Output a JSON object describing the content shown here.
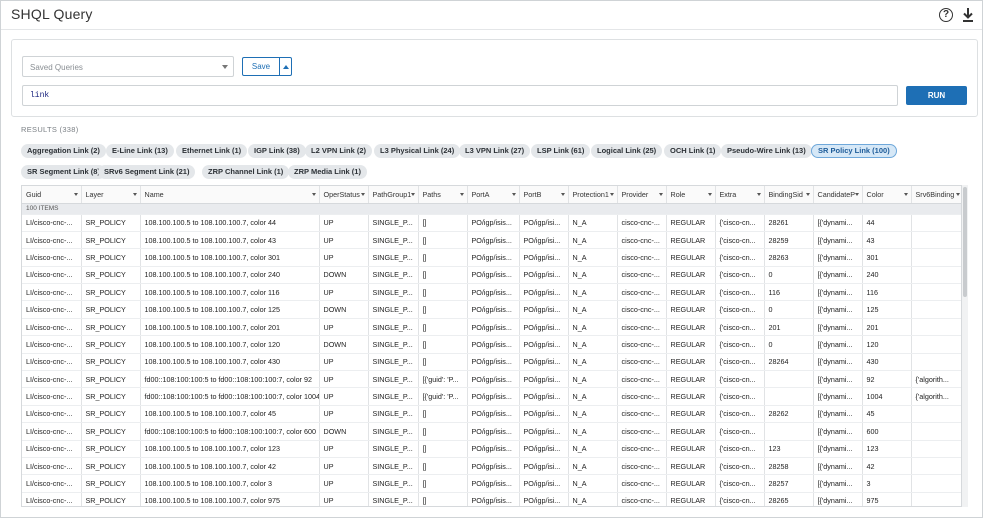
{
  "header": {
    "title": "SHQL Query",
    "help_icon": "help-icon",
    "download_icon": "download-icon"
  },
  "query_panel": {
    "saved_queries_placeholder": "Saved Queries",
    "save_label": "Save",
    "query_value": "link",
    "run_label": "RUN"
  },
  "results": {
    "label": "RESULTS (338)",
    "chips": [
      {
        "label": "Aggregation Link (2)",
        "active": false
      },
      {
        "label": "E-Line Link (13)",
        "active": false
      },
      {
        "label": "Ethernet Link (1)",
        "active": false
      },
      {
        "label": "IGP Link (38)",
        "active": false
      },
      {
        "label": "L2 VPN Link (2)",
        "active": false
      },
      {
        "label": "L3 Physical Link (24)",
        "active": false
      },
      {
        "label": "L3 VPN Link (27)",
        "active": false
      },
      {
        "label": "LSP Link (61)",
        "active": false
      },
      {
        "label": "Logical Link (25)",
        "active": false
      },
      {
        "label": "OCH Link (1)",
        "active": false
      },
      {
        "label": "Pseudo-Wire Link (13)",
        "active": false
      },
      {
        "label": "SR Policy Link (100)",
        "active": true
      },
      {
        "label": "SR Segment Link (8)",
        "active": false
      },
      {
        "label": "SRv6 Segment Link (21)",
        "active": false
      },
      {
        "label": "ZRP Channel Link (1)",
        "active": false
      },
      {
        "label": "ZRP Media Link (1)",
        "active": false
      }
    ]
  },
  "grid": {
    "columns": [
      "Guid",
      "Layer",
      "Name",
      "OperStatus",
      "PathGroup1",
      "Paths",
      "PortA",
      "PortB",
      "Protection1",
      "Provider",
      "Role",
      "Extra",
      "BindingSid",
      "CandidateP",
      "Color",
      "Srv6Binding"
    ],
    "group_label": "100 ITEMS",
    "rows": [
      [
        "LI/cisco-cnc-...",
        "SR_POLICY",
        "108.100.100.5 to 108.100.100.7, color 44",
        "UP",
        "SINGLE_P...",
        "[]",
        "PO/igp/isis...",
        "PO/igp/isi...",
        "N_A",
        "cisco-cnc-...",
        "REGULAR",
        "{'cisco-cn...",
        "28261",
        "[{'dynami...",
        "44",
        ""
      ],
      [
        "LI/cisco-cnc-...",
        "SR_POLICY",
        "108.100.100.5 to 108.100.100.7, color 43",
        "UP",
        "SINGLE_P...",
        "[]",
        "PO/igp/isis...",
        "PO/igp/isi...",
        "N_A",
        "cisco-cnc-...",
        "REGULAR",
        "{'cisco-cn...",
        "28259",
        "[{'dynami...",
        "43",
        ""
      ],
      [
        "LI/cisco-cnc-...",
        "SR_POLICY",
        "108.100.100.5 to 108.100.100.7, color 301",
        "UP",
        "SINGLE_P...",
        "[]",
        "PO/igp/isis...",
        "PO/igp/isi...",
        "N_A",
        "cisco-cnc-...",
        "REGULAR",
        "{'cisco-cn...",
        "28263",
        "[{'dynami...",
        "301",
        ""
      ],
      [
        "LI/cisco-cnc-...",
        "SR_POLICY",
        "108.100.100.5 to 108.100.100.7, color 240",
        "DOWN",
        "SINGLE_P...",
        "[]",
        "PO/igp/isis...",
        "PO/igp/isi...",
        "N_A",
        "cisco-cnc-...",
        "REGULAR",
        "{'cisco-cn...",
        "0",
        "[{'dynami...",
        "240",
        ""
      ],
      [
        "LI/cisco-cnc-...",
        "SR_POLICY",
        "108.100.100.5 to 108.100.100.7, color 116",
        "UP",
        "SINGLE_P...",
        "[]",
        "PO/igp/isis...",
        "PO/igp/isi...",
        "N_A",
        "cisco-cnc-...",
        "REGULAR",
        "{'cisco-cn...",
        "116",
        "[{'dynami...",
        "116",
        ""
      ],
      [
        "LI/cisco-cnc-...",
        "SR_POLICY",
        "108.100.100.5 to 108.100.100.7, color 125",
        "DOWN",
        "SINGLE_P...",
        "[]",
        "PO/igp/isis...",
        "PO/igp/isi...",
        "N_A",
        "cisco-cnc-...",
        "REGULAR",
        "{'cisco-cn...",
        "0",
        "[{'dynami...",
        "125",
        ""
      ],
      [
        "LI/cisco-cnc-...",
        "SR_POLICY",
        "108.100.100.5 to 108.100.100.7, color 201",
        "UP",
        "SINGLE_P...",
        "[]",
        "PO/igp/isis...",
        "PO/igp/isi...",
        "N_A",
        "cisco-cnc-...",
        "REGULAR",
        "{'cisco-cn...",
        "201",
        "[{'dynami...",
        "201",
        ""
      ],
      [
        "LI/cisco-cnc-...",
        "SR_POLICY",
        "108.100.100.5 to 108.100.100.7, color 120",
        "DOWN",
        "SINGLE_P...",
        "[]",
        "PO/igp/isis...",
        "PO/igp/isi...",
        "N_A",
        "cisco-cnc-...",
        "REGULAR",
        "{'cisco-cn...",
        "0",
        "[{'dynami...",
        "120",
        ""
      ],
      [
        "LI/cisco-cnc-...",
        "SR_POLICY",
        "108.100.100.5 to 108.100.100.7, color 430",
        "UP",
        "SINGLE_P...",
        "[]",
        "PO/igp/isis...",
        "PO/igp/isi...",
        "N_A",
        "cisco-cnc-...",
        "REGULAR",
        "{'cisco-cn...",
        "28264",
        "[{'dynami...",
        "430",
        ""
      ],
      [
        "LI/cisco-cnc-...",
        "SR_POLICY",
        "fd00::108:100:100:5 to fd00::108:100:100:7, color 92",
        "UP",
        "SINGLE_P...",
        "[{'guid': 'P...",
        "PO/igp/isis...",
        "PO/igp/isi...",
        "N_A",
        "cisco-cnc-...",
        "REGULAR",
        "{'cisco-cn...",
        "",
        "[{'dynami...",
        "92",
        "{'algorith..."
      ],
      [
        "LI/cisco-cnc-...",
        "SR_POLICY",
        "fd00::108:100:100:5 to fd00::108:100:100:7, color 1004",
        "UP",
        "SINGLE_P...",
        "[{'guid': 'P...",
        "PO/igp/isis...",
        "PO/igp/isi...",
        "N_A",
        "cisco-cnc-...",
        "REGULAR",
        "{'cisco-cn...",
        "",
        "[{'dynami...",
        "1004",
        "{'algorith..."
      ],
      [
        "LI/cisco-cnc-...",
        "SR_POLICY",
        "108.100.100.5 to 108.100.100.7, color 45",
        "UP",
        "SINGLE_P...",
        "[]",
        "PO/igp/isis...",
        "PO/igp/isi...",
        "N_A",
        "cisco-cnc-...",
        "REGULAR",
        "{'cisco-cn...",
        "28262",
        "[{'dynami...",
        "45",
        ""
      ],
      [
        "LI/cisco-cnc-...",
        "SR_POLICY",
        "fd00::108:100:100:5 to fd00::108:100:100:7, color 600",
        "DOWN",
        "SINGLE_P...",
        "[]",
        "PO/igp/isis...",
        "PO/igp/isi...",
        "N_A",
        "cisco-cnc-...",
        "REGULAR",
        "{'cisco-cn...",
        "",
        "[{'dynami...",
        "600",
        ""
      ],
      [
        "LI/cisco-cnc-...",
        "SR_POLICY",
        "108.100.100.5 to 108.100.100.7, color 123",
        "UP",
        "SINGLE_P...",
        "[]",
        "PO/igp/isis...",
        "PO/igp/isi...",
        "N_A",
        "cisco-cnc-...",
        "REGULAR",
        "{'cisco-cn...",
        "123",
        "[{'dynami...",
        "123",
        ""
      ],
      [
        "LI/cisco-cnc-...",
        "SR_POLICY",
        "108.100.100.5 to 108.100.100.7, color 42",
        "UP",
        "SINGLE_P...",
        "[]",
        "PO/igp/isis...",
        "PO/igp/isi...",
        "N_A",
        "cisco-cnc-...",
        "REGULAR",
        "{'cisco-cn...",
        "28258",
        "[{'dynami...",
        "42",
        ""
      ],
      [
        "LI/cisco-cnc-...",
        "SR_POLICY",
        "108.100.100.5 to 108.100.100.7, color 3",
        "UP",
        "SINGLE_P...",
        "[]",
        "PO/igp/isis...",
        "PO/igp/isi...",
        "N_A",
        "cisco-cnc-...",
        "REGULAR",
        "{'cisco-cn...",
        "28257",
        "[{'dynami...",
        "3",
        ""
      ],
      [
        "LI/cisco-cnc-...",
        "SR_POLICY",
        "108.100.100.5 to 108.100.100.7, color 975",
        "UP",
        "SINGLE_P...",
        "[]",
        "PO/igp/isis...",
        "PO/igp/isi...",
        "N_A",
        "cisco-cnc-...",
        "REGULAR",
        "{'cisco-cn...",
        "28265",
        "[{'dynami...",
        "975",
        ""
      ]
    ]
  }
}
